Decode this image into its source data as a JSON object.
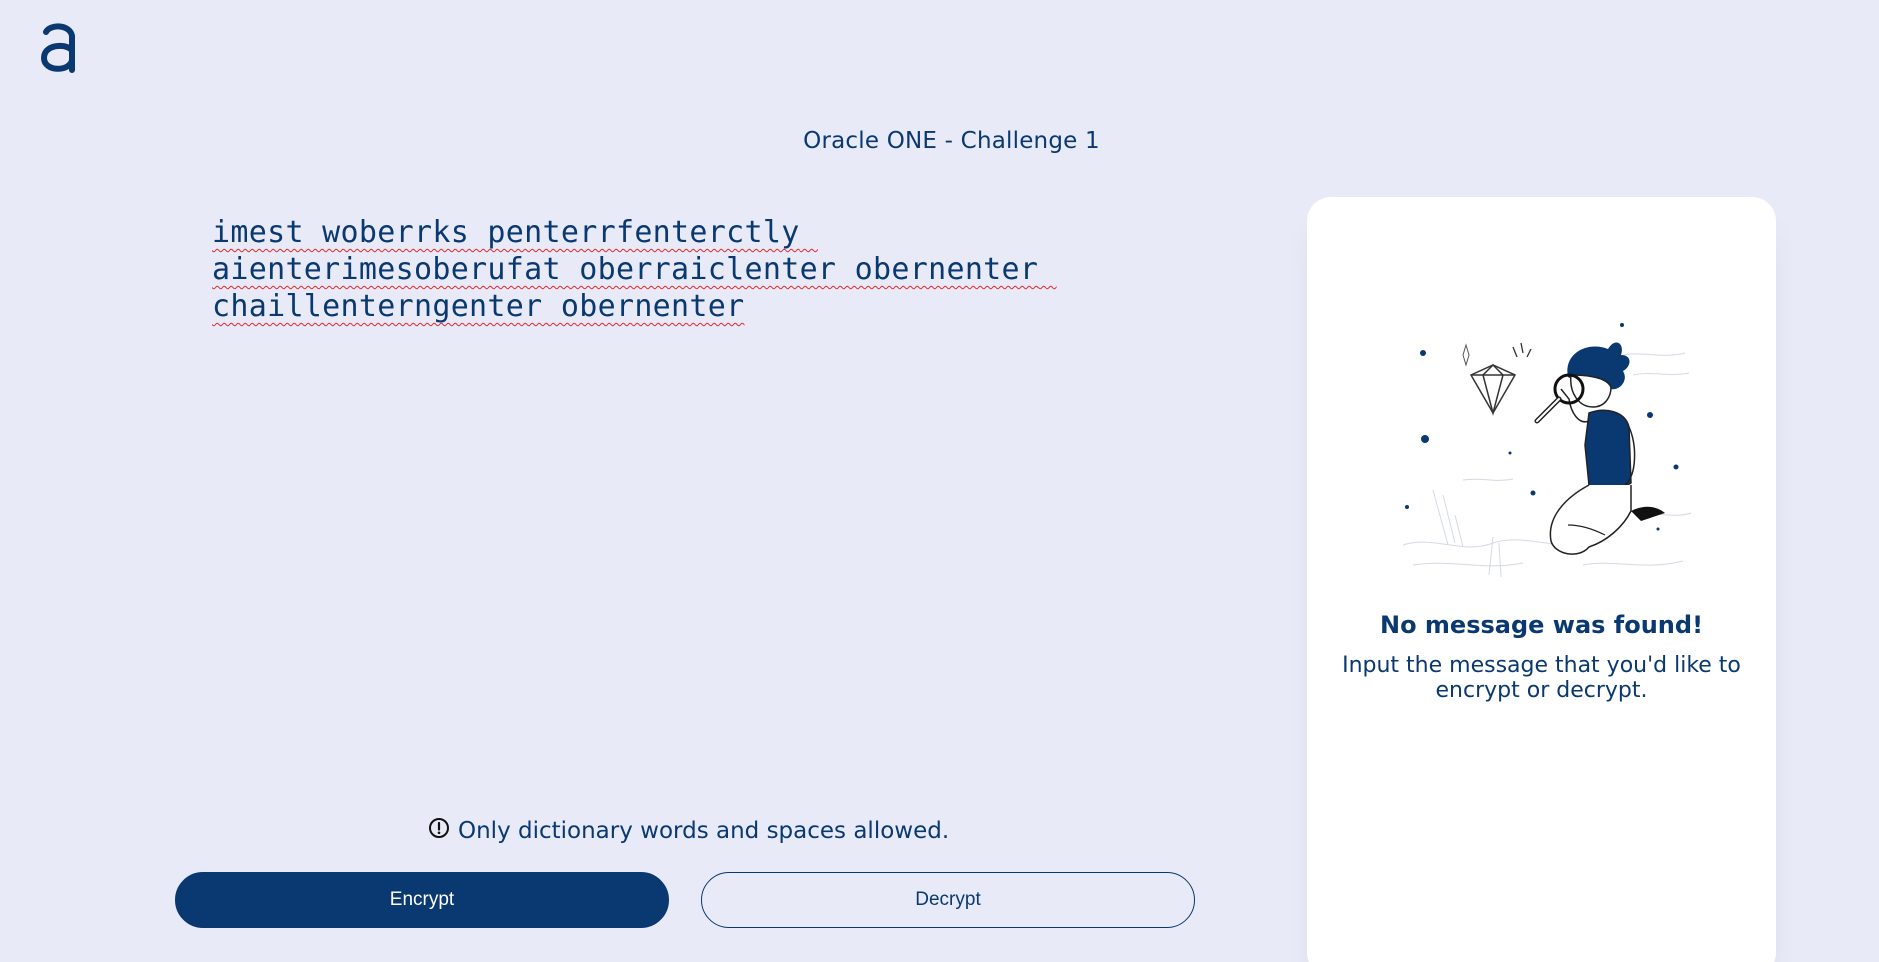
{
  "app": {
    "logo_icon": "alura-logo-icon",
    "accent_color": "#0a3871",
    "background_color": "#e8ebf7"
  },
  "header": {
    "title": "Oracle ONE - Challenge 1"
  },
  "editor": {
    "value": "imest woberrks penterrfenterctly aienterimesoberufat oberraiclenter obernenter chaillenterngenter obernenter"
  },
  "warning": {
    "icon": "exclamation-circle-icon",
    "text": "Only dictionary words and spaces allowed."
  },
  "actions": {
    "encrypt_label": "Encrypt",
    "decrypt_label": "Decrypt"
  },
  "output": {
    "illustration": "person-with-magnifying-glass-and-diamond",
    "heading": "No message was found!",
    "text": "Input the message that you'd like to encrypt or decrypt."
  }
}
